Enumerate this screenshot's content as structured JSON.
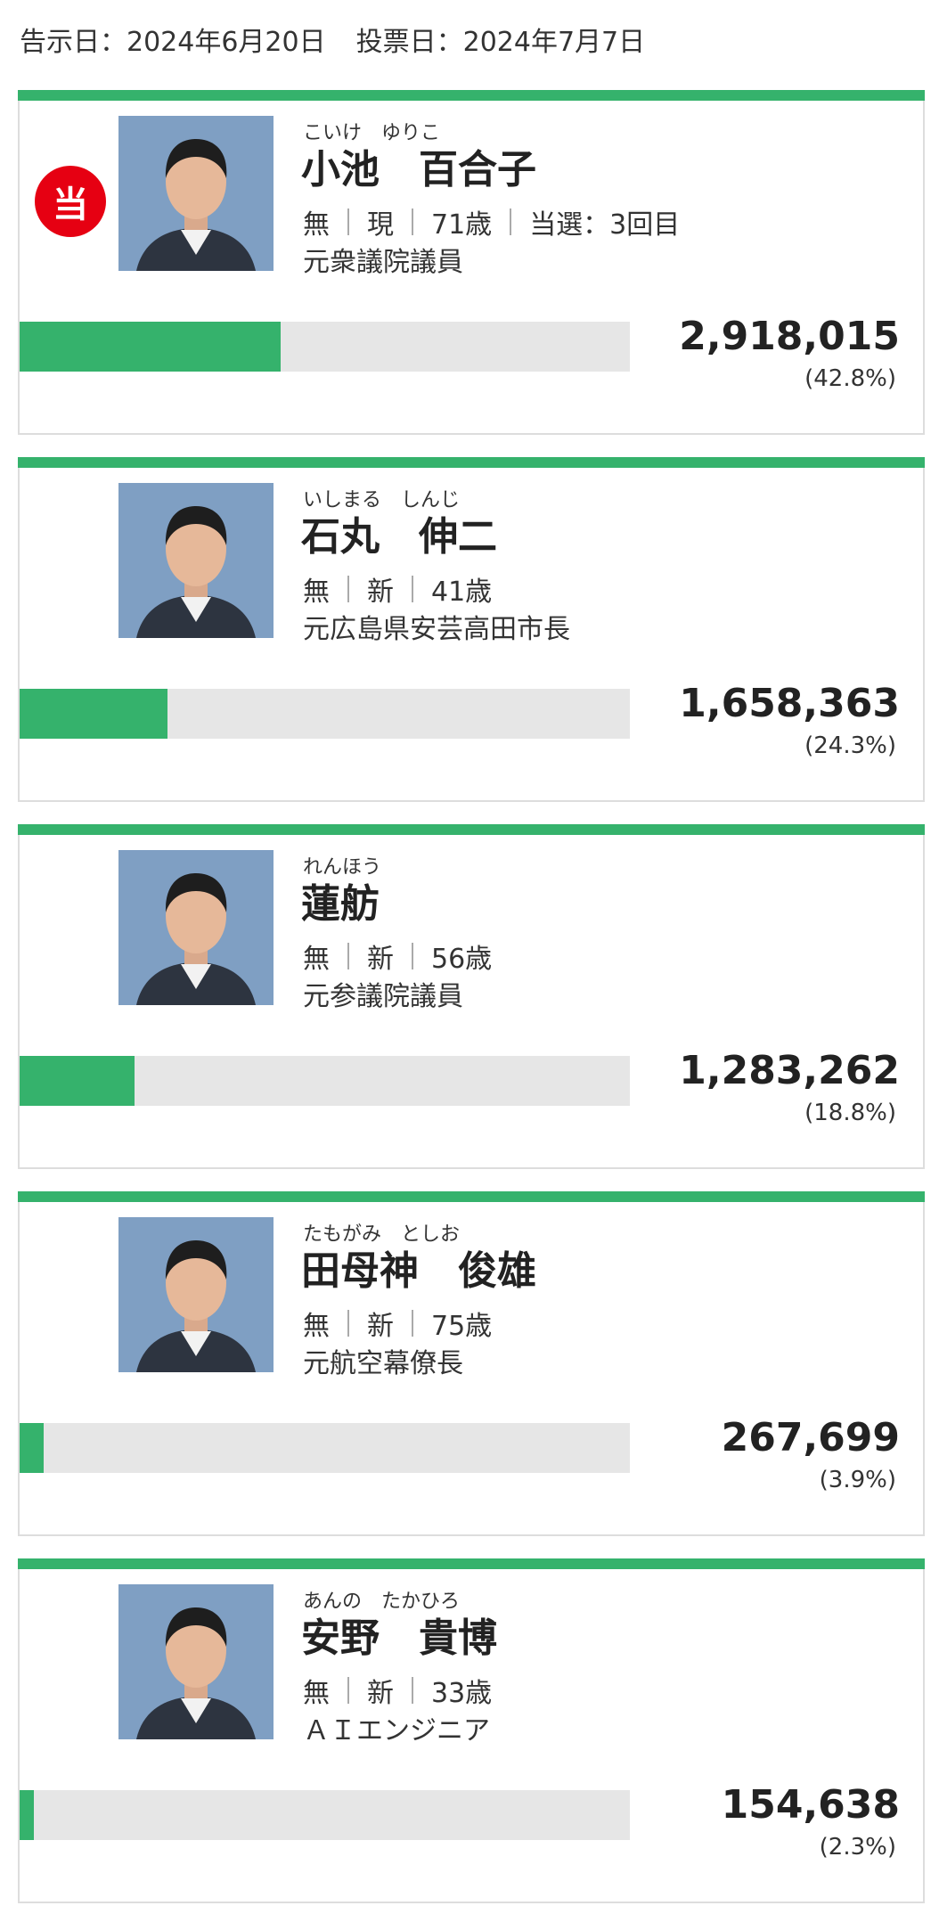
{
  "header": {
    "notice_date": "告示日：2024年6月20日",
    "vote_date": "投票日：2024年7月7日"
  },
  "colors": {
    "accent": "#35b26c",
    "elected_badge": "#e60012",
    "bar_track": "#e6e6e6"
  },
  "candidates": [
    {
      "kana": "こいけ　ゆりこ",
      "name": "小池　百合子",
      "party": "無",
      "status": "現",
      "age": "71歳",
      "elected_count": "当選：3回目",
      "career": "元衆議院議員",
      "votes": "2,918,015",
      "percent": "(42.8%)",
      "bar_fraction": 0.428,
      "elected": true,
      "elected_label": "当",
      "photo_icon": "candidate-portrait-icon"
    },
    {
      "kana": "いしまる　しんじ",
      "name": "石丸　伸二",
      "party": "無",
      "status": "新",
      "age": "41歳",
      "career": "元広島県安芸高田市長",
      "votes": "1,658,363",
      "percent": "(24.3%)",
      "bar_fraction": 0.243,
      "elected": false,
      "photo_icon": "candidate-portrait-icon"
    },
    {
      "kana": "れんほう",
      "name": "蓮舫",
      "party": "無",
      "status": "新",
      "age": "56歳",
      "career": "元参議院議員",
      "votes": "1,283,262",
      "percent": "(18.8%)",
      "bar_fraction": 0.188,
      "elected": false,
      "photo_icon": "candidate-portrait-icon"
    },
    {
      "kana": "たもがみ　としお",
      "name": "田母神　俊雄",
      "party": "無",
      "status": "新",
      "age": "75歳",
      "career": "元航空幕僚長",
      "votes": "267,699",
      "percent": "(3.9%)",
      "bar_fraction": 0.039,
      "elected": false,
      "photo_icon": "candidate-portrait-icon"
    },
    {
      "kana": "あんの　たかひろ",
      "name": "安野　貴博",
      "party": "無",
      "status": "新",
      "age": "33歳",
      "career": "ＡＩエンジニア",
      "votes": "154,638",
      "percent": "(2.3%)",
      "bar_fraction": 0.023,
      "elected": false,
      "photo_icon": "candidate-portrait-icon"
    }
  ]
}
